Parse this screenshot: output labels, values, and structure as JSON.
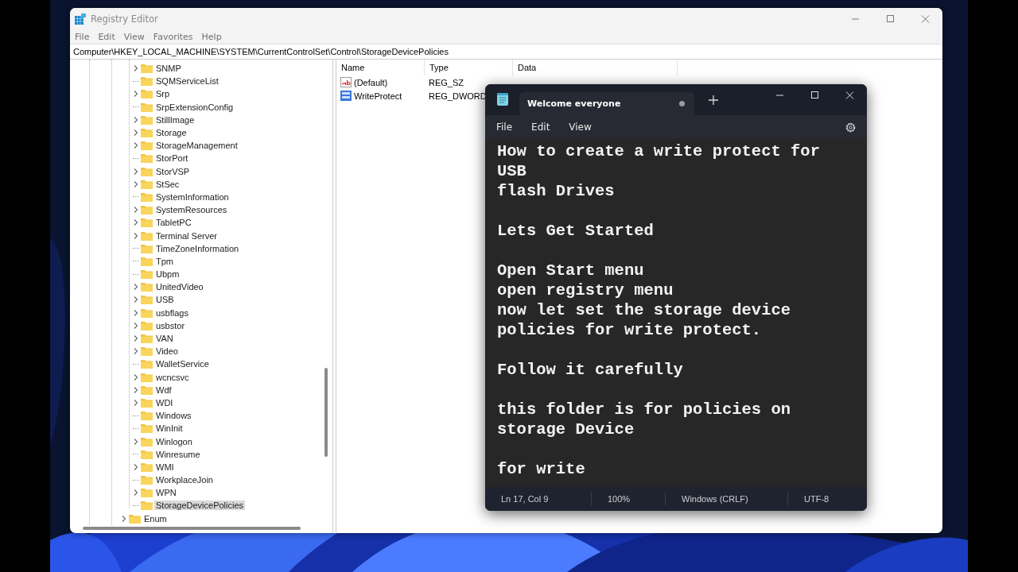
{
  "registry_window": {
    "title": "Registry Editor",
    "menu": [
      "File",
      "Edit",
      "View",
      "Favorites",
      "Help"
    ],
    "address": "Computer\\HKEY_LOCAL_MACHINE\\SYSTEM\\CurrentControlSet\\Control\\StorageDevicePolicies",
    "tree": {
      "nested_items": [
        {
          "label": "SNMP",
          "expandable": true,
          "selected": false
        },
        {
          "label": "SQMServiceList",
          "expandable": false,
          "selected": false
        },
        {
          "label": "Srp",
          "expandable": true,
          "selected": false
        },
        {
          "label": "SrpExtensionConfig",
          "expandable": false,
          "selected": false
        },
        {
          "label": "StillImage",
          "expandable": true,
          "selected": false
        },
        {
          "label": "Storage",
          "expandable": true,
          "selected": false
        },
        {
          "label": "StorageManagement",
          "expandable": true,
          "selected": false
        },
        {
          "label": "StorPort",
          "expandable": false,
          "selected": false
        },
        {
          "label": "StorVSP",
          "expandable": true,
          "selected": false
        },
        {
          "label": "StSec",
          "expandable": true,
          "selected": false
        },
        {
          "label": "SystemInformation",
          "expandable": false,
          "selected": false
        },
        {
          "label": "SystemResources",
          "expandable": true,
          "selected": false
        },
        {
          "label": "TabletPC",
          "expandable": true,
          "selected": false
        },
        {
          "label": "Terminal Server",
          "expandable": true,
          "selected": false
        },
        {
          "label": "TimeZoneInformation",
          "expandable": false,
          "selected": false
        },
        {
          "label": "Tpm",
          "expandable": false,
          "selected": false
        },
        {
          "label": "Ubpm",
          "expandable": false,
          "selected": false
        },
        {
          "label": "UnitedVideo",
          "expandable": true,
          "selected": false
        },
        {
          "label": "USB",
          "expandable": true,
          "selected": false
        },
        {
          "label": "usbflags",
          "expandable": true,
          "selected": false
        },
        {
          "label": "usbstor",
          "expandable": true,
          "selected": false
        },
        {
          "label": "VAN",
          "expandable": true,
          "selected": false
        },
        {
          "label": "Video",
          "expandable": true,
          "selected": false
        },
        {
          "label": "WalletService",
          "expandable": false,
          "selected": false
        },
        {
          "label": "wcncsvc",
          "expandable": true,
          "selected": false
        },
        {
          "label": "Wdf",
          "expandable": true,
          "selected": false
        },
        {
          "label": "WDI",
          "expandable": true,
          "selected": false
        },
        {
          "label": "Windows",
          "expandable": false,
          "selected": false
        },
        {
          "label": "WinInit",
          "expandable": false,
          "selected": false
        },
        {
          "label": "Winlogon",
          "expandable": true,
          "selected": false
        },
        {
          "label": "Winresume",
          "expandable": false,
          "selected": false
        },
        {
          "label": "WMI",
          "expandable": true,
          "selected": false
        },
        {
          "label": "WorkplaceJoin",
          "expandable": false,
          "selected": false
        },
        {
          "label": "WPN",
          "expandable": true,
          "selected": false
        },
        {
          "label": "StorageDevicePolicies",
          "expandable": false,
          "selected": true
        }
      ],
      "items": [
        {
          "label": "Enum",
          "expandable": true,
          "selected": false
        }
      ]
    },
    "values": {
      "columns": [
        "Name",
        "Type",
        "Data"
      ],
      "rows": [
        {
          "kind": "string",
          "name": "(Default)",
          "type": "REG_SZ"
        },
        {
          "kind": "binary",
          "name": "WriteProtect",
          "type": "REG_DWORD"
        }
      ]
    }
  },
  "notepad_window": {
    "tab": {
      "title": "Welcome everyone",
      "selected": true,
      "unsaved": true
    },
    "menu": [
      "File",
      "Edit",
      "View"
    ],
    "paragraphs": [
      [
        "How to create a write protect for",
        "USB",
        "flash Drives"
      ],
      [
        "Lets Get Started"
      ],
      [
        "Open Start menu",
        "open registry menu",
        "now let set the storage device",
        "policies for write protect."
      ],
      [
        "Follow it carefully"
      ],
      [
        "this folder is for policies on",
        "storage Device"
      ],
      [
        "for write"
      ]
    ],
    "status_bar": [
      "Ln 17, Col 9",
      "100%",
      "Windows (CRLF)",
      "UTF-8"
    ]
  }
}
